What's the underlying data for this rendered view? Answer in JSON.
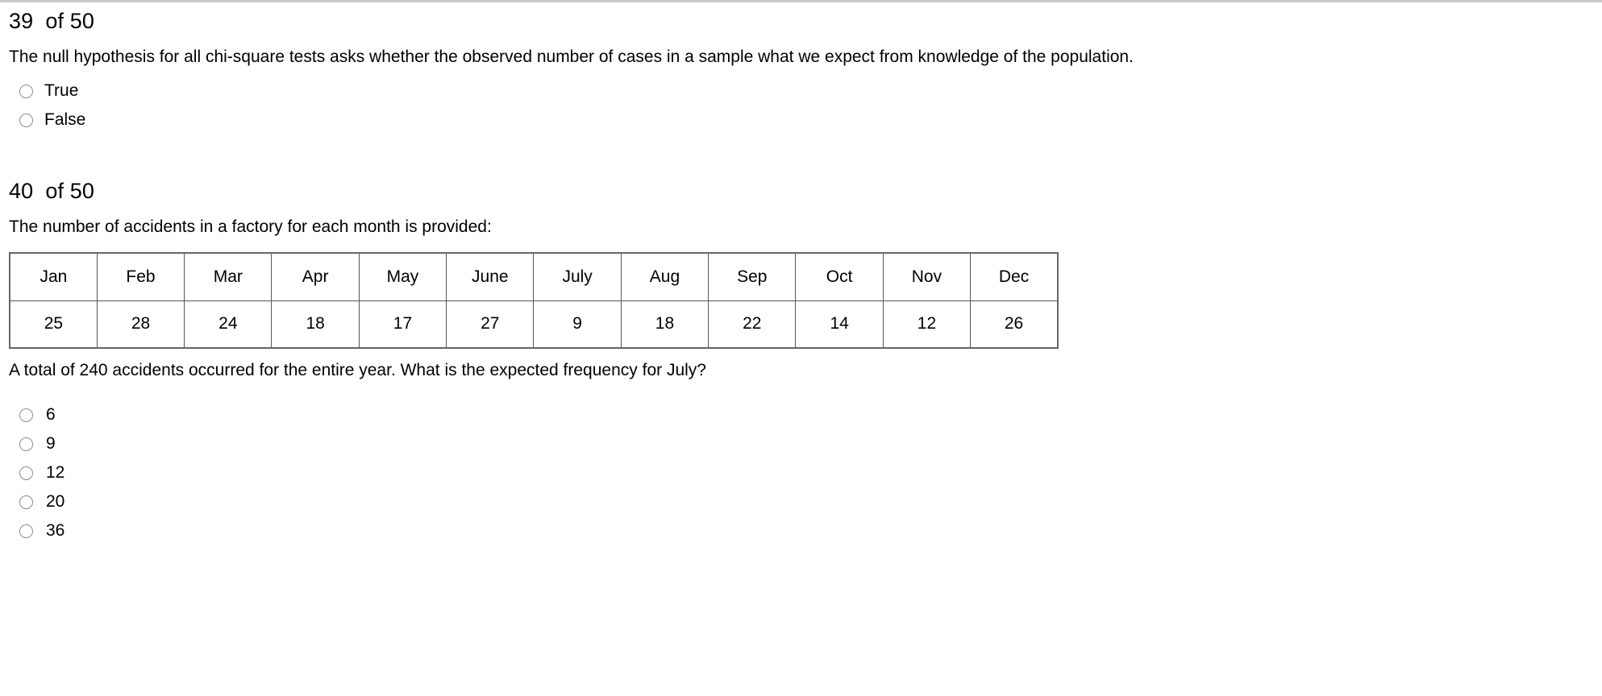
{
  "page": {
    "background": "#ffffff",
    "divider_color": "#c9c9c9",
    "radio_border_color": "#8c8c8c",
    "table_border_color": "#555555"
  },
  "questions": [
    {
      "number": "39",
      "of_label": "of",
      "total": "50",
      "heading": "39  of 50",
      "text": "The null hypothesis for all chi-square tests asks whether the observed number of cases in a sample what we expect from knowledge of the population.",
      "options": [
        {
          "label": "True",
          "selected": false
        },
        {
          "label": "False",
          "selected": false
        }
      ]
    },
    {
      "number": "40",
      "of_label": "of",
      "total": "50",
      "heading": "40  of 50",
      "text": "The number of accidents in a factory for each month is provided:",
      "subtext": "A total of 240 accidents occurred for the entire year. What is the expected frequency for July?",
      "table": {
        "months": [
          "Jan",
          "Feb",
          "Mar",
          "Apr",
          "May",
          "June",
          "July",
          "Aug",
          "Sep",
          "Oct",
          "Nov",
          "Dec"
        ],
        "counts": [
          "25",
          "28",
          "24",
          "18",
          "17",
          "27",
          "9",
          "18",
          "22",
          "14",
          "12",
          "26"
        ]
      },
      "options": [
        {
          "label": "6",
          "selected": false
        },
        {
          "label": "9",
          "selected": false
        },
        {
          "label": "12",
          "selected": false
        },
        {
          "label": "20",
          "selected": false
        },
        {
          "label": "36",
          "selected": false
        }
      ]
    }
  ]
}
